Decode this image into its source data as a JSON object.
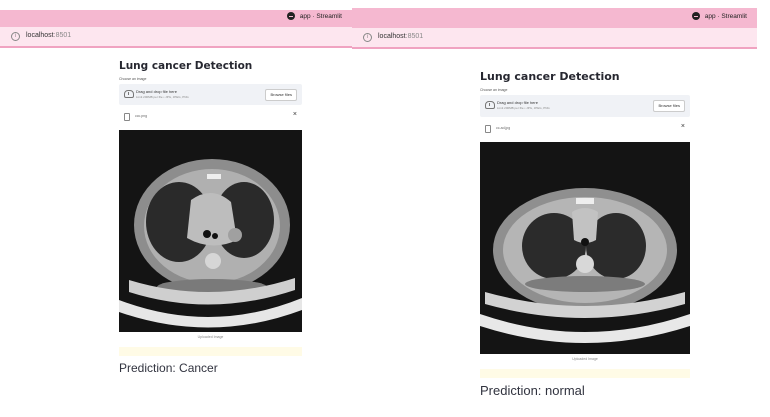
{
  "left": {
    "window_title": "app · Streamlit",
    "url_host": "localhost",
    "url_port": ":8501",
    "app_title": "Lung cancer Detection",
    "file_label": "Choose an image",
    "drop_text": "Drag and drop file here",
    "limit_text": "Limit 200MB per file • JPG, JPEG, PNG",
    "browse_label": "Browse files",
    "file_name": "ccc.png",
    "close_glyph": "×",
    "caption": "Uploaded Image",
    "prediction": "Prediction: Cancer"
  },
  "right": {
    "window_title": "app · Streamlit",
    "url_host": "localhost",
    "url_port": ":8501",
    "app_title": "Lung cancer Detection",
    "file_label": "Choose an image",
    "drop_text": "Drag and drop file here",
    "limit_text": "Limit 200MB per file • JPG, JPEG, PNG",
    "browse_label": "Browse files",
    "file_name": "cc-ad.jpg",
    "close_glyph": "×",
    "caption": "Uploaded Image",
    "prediction": "Prediction: normal"
  },
  "colors": {
    "titlebar": "#f5b8d0",
    "addressbar": "#fde6ef",
    "uploader_bg": "#f0f2f6",
    "alert_bg": "#fffbe6"
  }
}
